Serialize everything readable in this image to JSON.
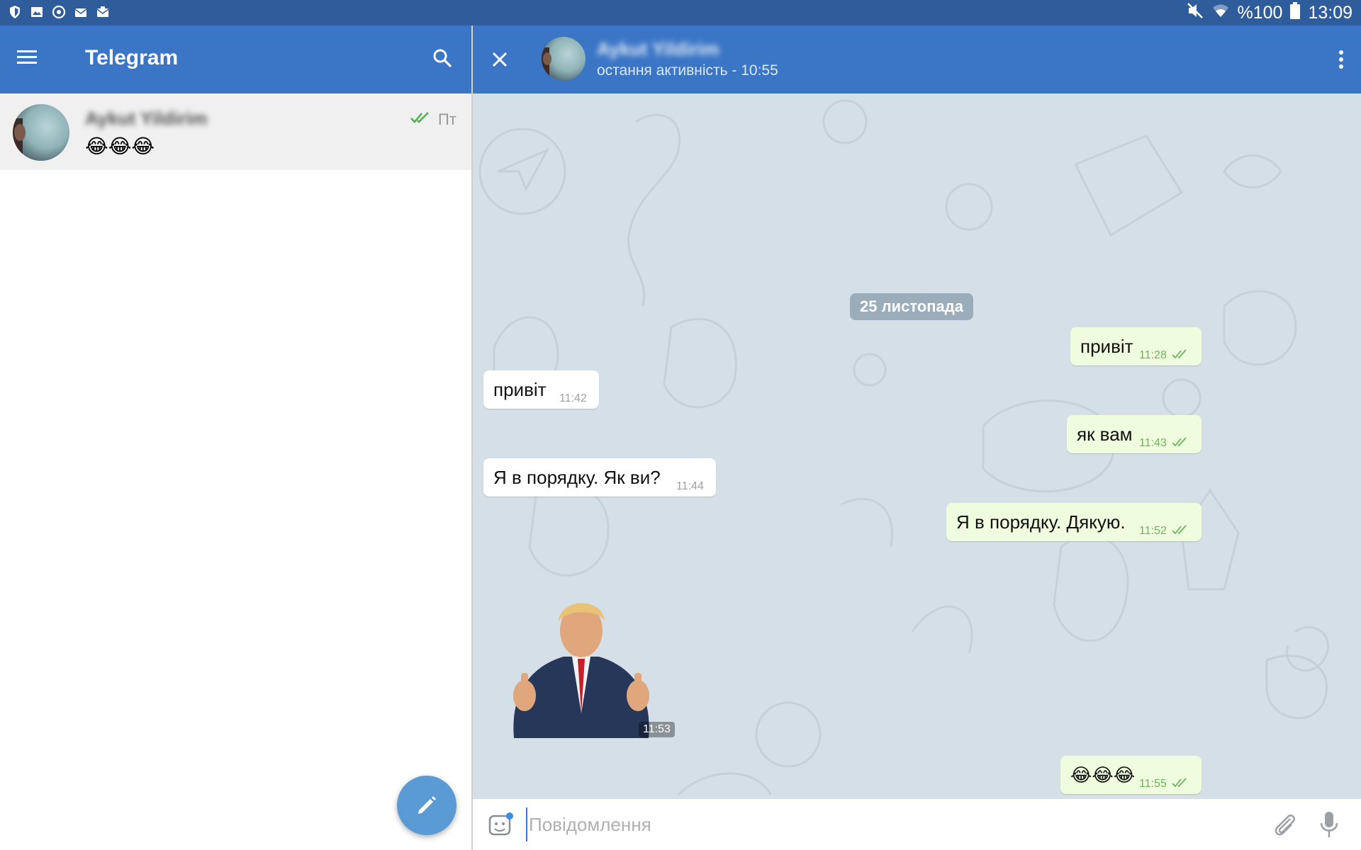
{
  "status_bar": {
    "battery": "%100",
    "time": "13:09",
    "left_icons": [
      "shield-icon",
      "image-icon",
      "sync-icon",
      "mail-icon",
      "mail-alt-icon"
    ]
  },
  "left_pane": {
    "app_title": "Telegram",
    "chats": [
      {
        "name": "Aykut Yildirim",
        "preview": "😂😂😂",
        "date": "Пт",
        "read": true
      }
    ]
  },
  "chat_header": {
    "contact_name": "Aykut Yildirim",
    "status": "остання активність - 10:55"
  },
  "conversation": {
    "date_divider": "25 листопада",
    "messages": [
      {
        "direction": "out",
        "text": "привіт",
        "time": "11:28",
        "read": true
      },
      {
        "direction": "in",
        "text": "привіт",
        "time": "11:42"
      },
      {
        "direction": "out",
        "text": "як вам",
        "time": "11:43",
        "read": true
      },
      {
        "direction": "in",
        "text": "Я в порядку. Як ви?",
        "time": "11:44"
      },
      {
        "direction": "out",
        "text": "Я в порядку. Дякую.",
        "time": "11:52",
        "read": true
      },
      {
        "direction": "in",
        "type": "sticker",
        "time": "11:53"
      },
      {
        "direction": "out",
        "text": "😂😂😂",
        "time": "11:55",
        "read": true
      }
    ]
  },
  "input": {
    "placeholder": "Повідомлення"
  },
  "colors": {
    "header": "#3b76c6",
    "status_bar": "#2f5d9b",
    "outgoing_bubble": "#effdde",
    "read_tick": "#6cb35e",
    "fab": "#5b9bd5"
  }
}
